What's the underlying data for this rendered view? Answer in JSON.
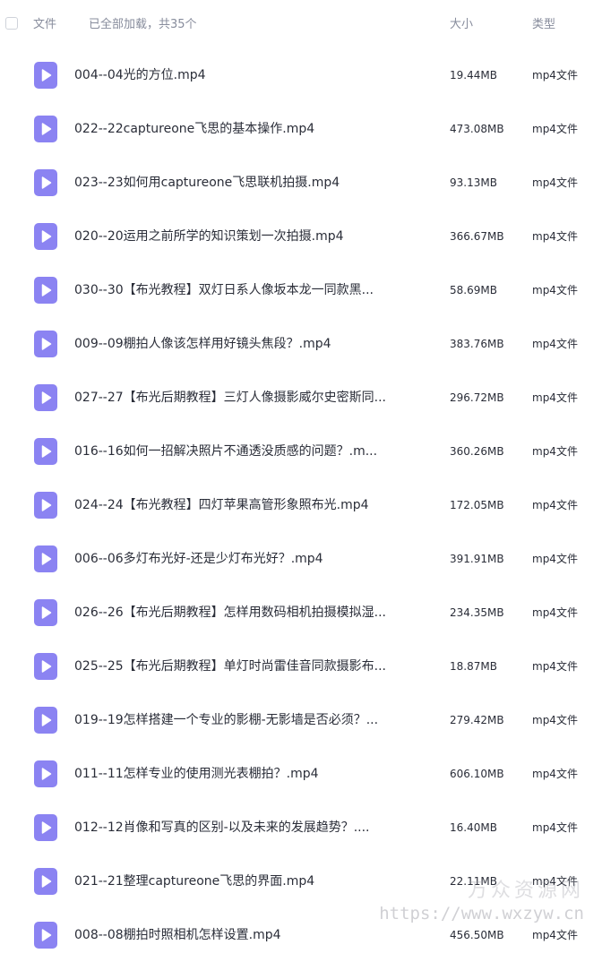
{
  "header": {
    "column_name": "文件",
    "load_status": "已全部加载，共35个",
    "column_size": "大小",
    "column_type": "类型"
  },
  "file_icon": "video-file-icon",
  "accent_color": "#8b83f2",
  "files": [
    {
      "name": "004--04光的方位.mp4",
      "size": "19.44MB",
      "type": "mp4文件"
    },
    {
      "name": "022--22captureone飞思的基本操作.mp4",
      "size": "473.08MB",
      "type": "mp4文件"
    },
    {
      "name": "023--23如何用captureone飞思联机拍摄.mp4",
      "size": "93.13MB",
      "type": "mp4文件"
    },
    {
      "name": "020--20运用之前所学的知识策划一次拍摄.mp4",
      "size": "366.67MB",
      "type": "mp4文件"
    },
    {
      "name": "030--30【布光教程】双灯日系人像坂本龙一同款黑...",
      "size": "58.69MB",
      "type": "mp4文件"
    },
    {
      "name": "009--09棚拍人像该怎样用好镜头焦段？.mp4",
      "size": "383.76MB",
      "type": "mp4文件"
    },
    {
      "name": "027--27【布光后期教程】三灯人像摄影威尔史密斯同...",
      "size": "296.72MB",
      "type": "mp4文件"
    },
    {
      "name": "016--16如何一招解决照片不通透没质感的问题？.m...",
      "size": "360.26MB",
      "type": "mp4文件"
    },
    {
      "name": "024--24【布光教程】四灯苹果高管形象照布光.mp4",
      "size": "172.05MB",
      "type": "mp4文件"
    },
    {
      "name": "006--06多灯布光好-还是少灯布光好？.mp4",
      "size": "391.91MB",
      "type": "mp4文件"
    },
    {
      "name": "026--26【布光后期教程】怎样用数码相机拍摄模拟湿...",
      "size": "234.35MB",
      "type": "mp4文件"
    },
    {
      "name": "025--25【布光后期教程】单灯时尚雷佳音同款摄影布...",
      "size": "18.87MB",
      "type": "mp4文件"
    },
    {
      "name": "019--19怎样搭建一个专业的影棚-无影墙是否必须？...",
      "size": "279.42MB",
      "type": "mp4文件"
    },
    {
      "name": "011--11怎样专业的使用测光表棚拍？.mp4",
      "size": "606.10MB",
      "type": "mp4文件"
    },
    {
      "name": "012--12肖像和写真的区别-以及未来的发展趋势？....",
      "size": "16.40MB",
      "type": "mp4文件"
    },
    {
      "name": "021--21整理captureone飞思的界面.mp4",
      "size": "22.11MB",
      "type": "mp4文件"
    },
    {
      "name": "008--08棚拍时照相机怎样设置.mp4",
      "size": "456.50MB",
      "type": "mp4文件"
    }
  ],
  "watermark": {
    "text_cn": "万众资源网",
    "url": "https://www.wxzyw.cn"
  }
}
